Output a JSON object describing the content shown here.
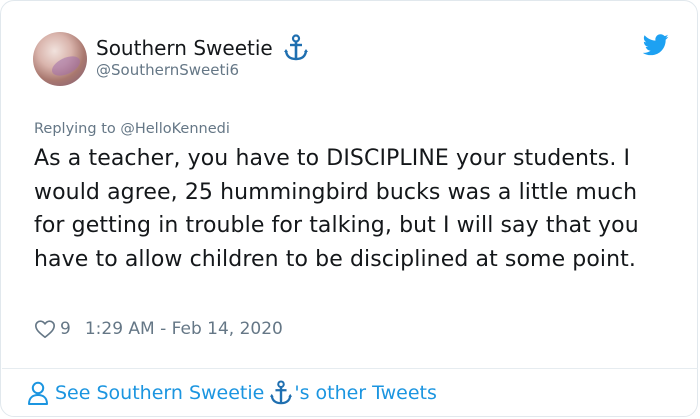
{
  "tweet": {
    "author_name": "Southern Sweetie",
    "author_handle": "@SouthernSweeti6",
    "reply_prefix": "Replying to",
    "reply_to": "@HelloKennedi",
    "text": "As a teacher, you have to DISCIPLINE your students. I would agree, 25 hummingbird bucks was a little much for getting in trouble for talking, but I will say that you have to allow children to be disciplined at some point.",
    "likes": "9",
    "timestamp": "1:29 AM - Feb 14, 2020"
  },
  "footer": {
    "prefix": "See Southern Sweetie",
    "suffix": "'s other Tweets"
  },
  "colors": {
    "accent": "#1b95e0",
    "twitter_blue": "#1da1f2",
    "muted": "#657786",
    "text": "#14171a"
  },
  "icons": {
    "name_badge": "anchor-icon",
    "brand": "twitter-bird-icon",
    "like": "heart-icon",
    "profile": "person-icon"
  }
}
